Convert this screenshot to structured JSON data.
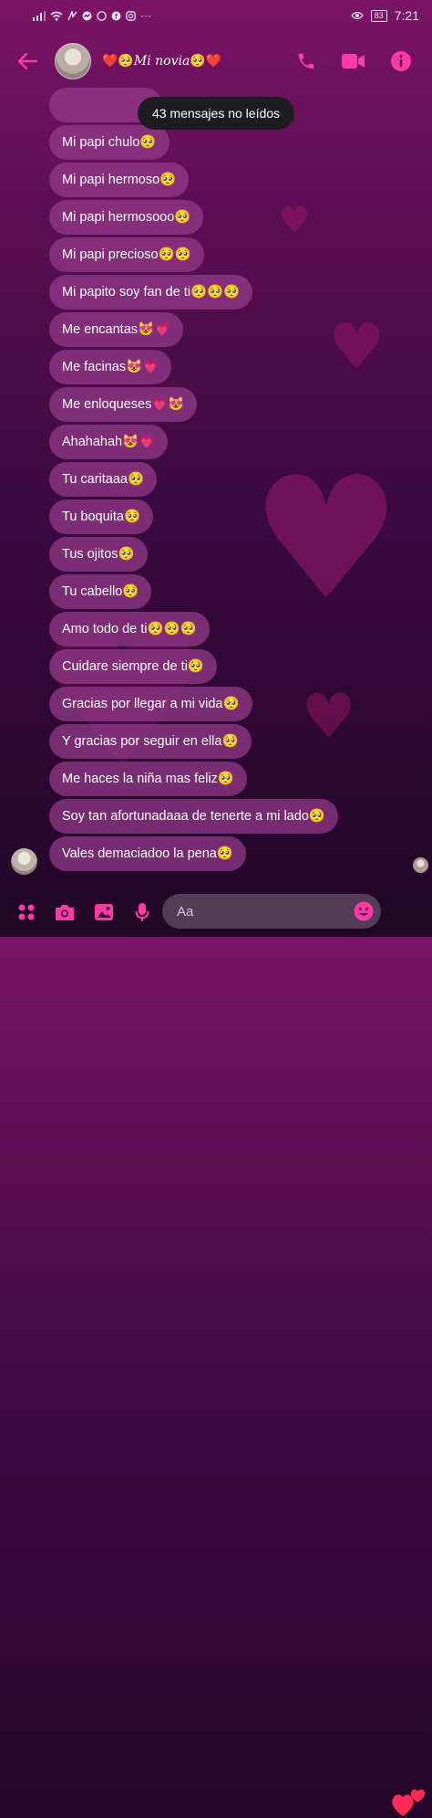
{
  "status_bar": {
    "time": "7:21",
    "battery": "83",
    "more": "···"
  },
  "header": {
    "contact_name": "Mi novia",
    "name_emoji_left": "❤️🥺",
    "name_emoji_right": "🥺❤️"
  },
  "unread_toast": "43 mensajes no leídos",
  "messages": [
    {
      "text": ""
    },
    {
      "text": "Mi papi chulo🥺"
    },
    {
      "text": "Mi papi hermoso🥺"
    },
    {
      "text": "Mi papi hermosooo🥺"
    },
    {
      "text": "Mi papi precioso🥺🥺"
    },
    {
      "text": "Mi papito soy fan de ti🥺🥺🥺"
    },
    {
      "text": "Me encantas😻💗"
    },
    {
      "text": "Me facinas😻💗"
    },
    {
      "text": "Me enloqueses💗😻"
    },
    {
      "text": "Ahahahah😻💗"
    },
    {
      "text": "Tu caritaaa🥺"
    },
    {
      "text": "Tu boquita🥺"
    },
    {
      "text": "Tus ojitos🥺"
    },
    {
      "text": "Tu cabello🥺"
    },
    {
      "text": "Amo todo de ti🥺🥺🥺"
    },
    {
      "text": "Cuidare siempre de ti🥺"
    },
    {
      "text": "Gracias por llegar a mi vida🥺"
    },
    {
      "text": "Y gracias por seguir en ella🥺"
    },
    {
      "text": "Me haces la niña mas feliz🥺"
    },
    {
      "text": "Soy tan afortunadaaa de tenerte a mi lado🥺"
    },
    {
      "text": "Vales demaciadoo la pena🥺"
    }
  ],
  "composer": {
    "placeholder": "Aa"
  },
  "colors": {
    "accent": "#ff3aa5",
    "bubble": "#96388c",
    "toast": "#1d1c21"
  },
  "icons": [
    "back-arrow-icon",
    "phone-icon",
    "video-camera-icon",
    "info-icon",
    "grid-menu-icon",
    "camera-icon",
    "gallery-icon",
    "microphone-icon",
    "emoji-icon",
    "hearts-send-icon"
  ]
}
